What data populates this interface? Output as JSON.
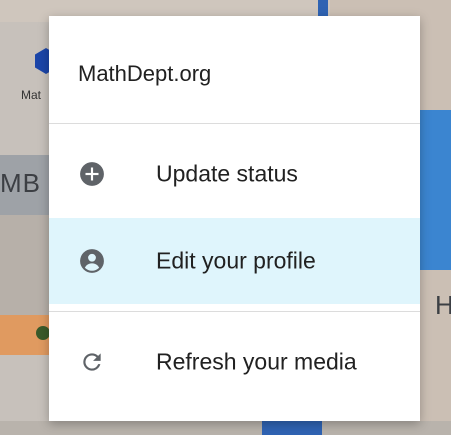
{
  "menu": {
    "title": "MathDept.org",
    "items": [
      {
        "label": "Update status",
        "icon": "add-circle-icon"
      },
      {
        "label": "Edit your profile",
        "icon": "account-circle-icon",
        "selected": true
      },
      {
        "label": "Refresh your media",
        "icon": "refresh-icon"
      }
    ]
  },
  "background": {
    "labels": [
      "Mat",
      "MB",
      "H"
    ]
  },
  "colors": {
    "selected_bg": "#dff5fc",
    "icon": "#5f6368",
    "text": "#212121"
  }
}
